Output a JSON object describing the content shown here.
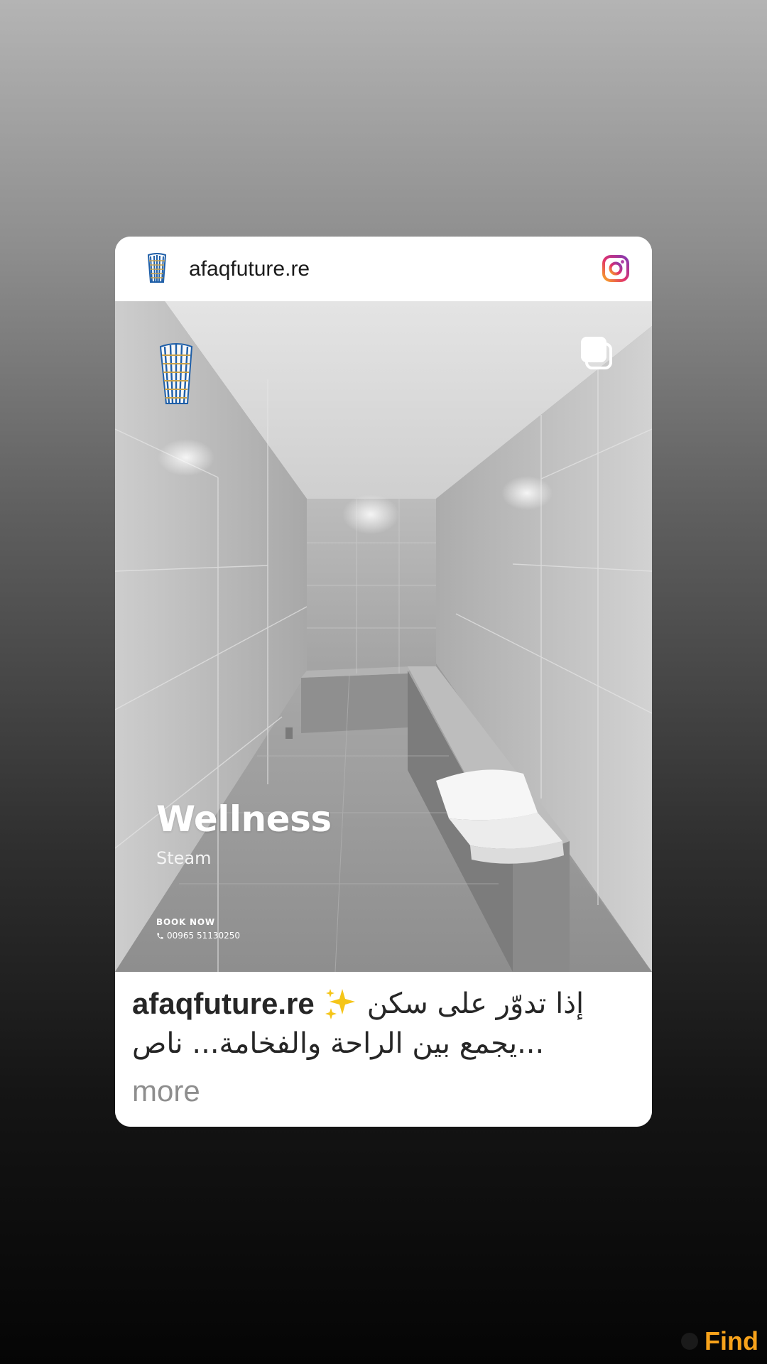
{
  "post": {
    "username": "afaqfuture.re",
    "media": {
      "title": "Wellness",
      "subtitle": "Steam",
      "book_label": "BOOK NOW",
      "phone": "00965 51130250"
    },
    "caption": {
      "username": "afaqfuture.re",
      "line1": "إذا تدوّر على سكن",
      "line2": "...يجمع بين الراحة والفخامة... ناص",
      "more": "more"
    }
  },
  "overlay": {
    "find_label": "Find"
  },
  "colors": {
    "find_accent": "#f7a21b",
    "logo_blue": "#1f5fa8",
    "logo_gold": "#c9a24a"
  },
  "icons": {
    "header_avatar": "building-logo-icon",
    "platform": "instagram-icon",
    "media_logo": "building-logo-icon",
    "multi_post": "carousel-icon",
    "phone": "phone-icon",
    "sparkle": "sparkles-icon",
    "find": "search-circle-icon"
  }
}
